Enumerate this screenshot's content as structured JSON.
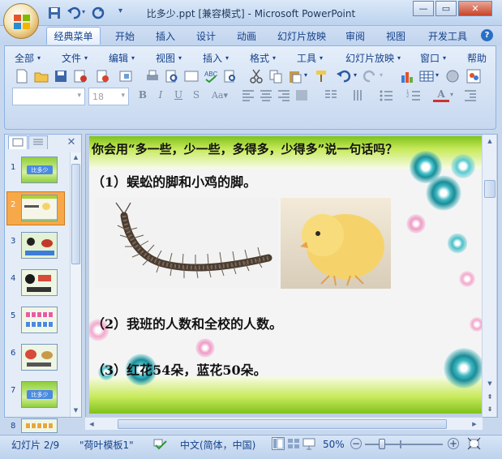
{
  "window": {
    "title": "比多少.ppt [兼容模式] - Microsoft PowerPoint"
  },
  "tabs": [
    "经典菜单",
    "开始",
    "插入",
    "设计",
    "动画",
    "幻灯片放映",
    "审阅",
    "视图",
    "开发工具"
  ],
  "menus": [
    "全部",
    "文件",
    "编辑",
    "视图",
    "插入",
    "格式",
    "工具",
    "幻灯片放映",
    "窗口",
    "帮助"
  ],
  "font_size": "18",
  "thumbnails": [
    {
      "num": "1",
      "label": "比多少"
    },
    {
      "num": "2",
      "label": ""
    },
    {
      "num": "3",
      "label": ""
    },
    {
      "num": "4",
      "label": ""
    },
    {
      "num": "5",
      "label": ""
    },
    {
      "num": "6",
      "label": ""
    },
    {
      "num": "7",
      "label": "比多少"
    },
    {
      "num": "8",
      "label": ""
    }
  ],
  "slide": {
    "question": "你会用“多一些，少一些，多得多，少得多”说一句话吗？",
    "item1": "（1）蜈蚣的脚和小鸡的脚。",
    "item2": "（2）我班的人数和全校的人数。",
    "item3": "（3）红花54朵，蓝花50朵。"
  },
  "status": {
    "slide_info": "幻灯片 2/9",
    "template": "\"荷叶模板1\"",
    "language": "中文(简体，中国)",
    "zoom": "50%"
  },
  "colors": {
    "selected_thumb": "#f7a94a",
    "slide_green_band": "#a9d23a",
    "bubble_teal": "#1fa6a8"
  }
}
